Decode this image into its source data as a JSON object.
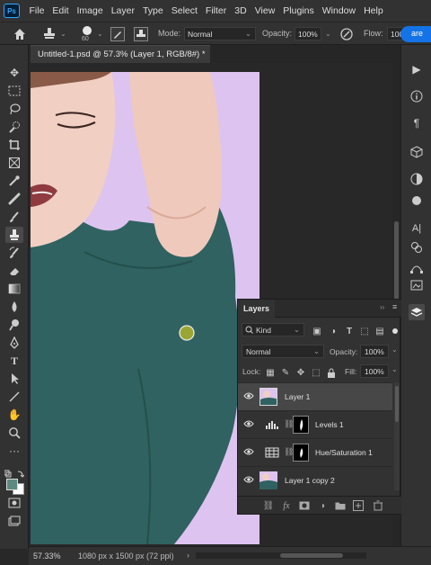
{
  "app": {
    "logo_text": "Ps"
  },
  "menu": [
    "File",
    "Edit",
    "Image",
    "Layer",
    "Type",
    "Select",
    "Filter",
    "3D",
    "View",
    "Plugins",
    "Window",
    "Help"
  ],
  "options_bar": {
    "brush_size": "60",
    "mode_label": "Mode:",
    "mode_value": "Normal",
    "opacity_label": "Opacity:",
    "opacity_value": "100%",
    "flow_label": "Flow:",
    "flow_value": "100%",
    "share_label": "are"
  },
  "document": {
    "tab_title": "Untitled-1.psd @ 57.3% (Layer 1, RGB/8#) *"
  },
  "layers_panel": {
    "title": "Layers",
    "filter_kind": "Kind",
    "blend_mode": "Normal",
    "opacity_label": "Opacity:",
    "opacity_value": "100%",
    "lock_label": "Lock:",
    "fill_label": "Fill:",
    "fill_value": "100%",
    "layers": [
      {
        "name": "Layer 1",
        "selected": true
      },
      {
        "name": "Levels 1",
        "selected": false
      },
      {
        "name": "Hue/Saturation 1",
        "selected": false
      },
      {
        "name": "Layer 1 copy 2",
        "selected": false
      }
    ]
  },
  "status": {
    "zoom": "57.33%",
    "doc_info": "1080 px x 1500 px (72 ppi)"
  },
  "colors": {
    "accent_blue": "#1473e6",
    "canvas_background": "#ddc3ef",
    "shirt": "#2f6260",
    "cursor": "#9aa633"
  }
}
